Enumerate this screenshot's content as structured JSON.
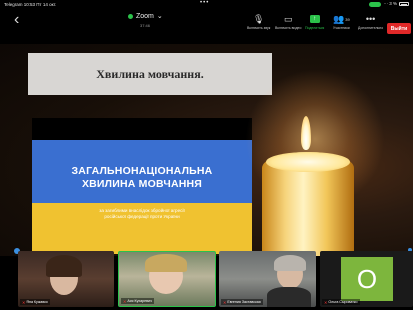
{
  "status_bar": {
    "left": "Telegram  10:53  Пт 14 окт.",
    "dots": "•••",
    "right": "⋯ 3 %"
  },
  "header": {
    "back_icon": "chevron-left-icon",
    "app_title": "Zoom",
    "title_chevron": "⌄",
    "subtitle": "37:46"
  },
  "toolbar": {
    "tools": [
      {
        "icon": "mic-muted-icon",
        "label": "Включить звук"
      },
      {
        "icon": "video-off-icon",
        "label": "Включить видео"
      },
      {
        "icon": "share-icon",
        "label": "Поделиться"
      },
      {
        "icon": "participants-icon",
        "label": "Участники",
        "count": "39"
      },
      {
        "icon": "more-icon",
        "label": "Дополнительно"
      }
    ],
    "leave_label": "Выйти"
  },
  "shared_slide": {
    "banner_text": "Хвилина мовчання.",
    "flag_title_line1": "ЗАГАЛЬНОНАЦІОНАЛЬНА",
    "flag_title_line2": "ХВИЛИНА МОВЧАННЯ",
    "flag_subtitle_line1": "за загиблими внаслідок збройної агресії",
    "flag_subtitle_line2": "російської федерації проти України"
  },
  "participants": [
    {
      "name": "Яна Кужавко",
      "muted": true
    },
    {
      "name": "Ася Кухаревич",
      "muted": true,
      "active_speaker": true
    },
    {
      "name": "Евгения Заставская",
      "muted": true
    },
    {
      "name": "Ольга Сыроватко",
      "muted": true,
      "avatar_letter": "О"
    }
  ],
  "colors": {
    "accent_green": "#2bc24a",
    "leave_red": "#e02828",
    "flag_blue": "#3a6fd0",
    "flag_yellow": "#f0c230",
    "avatar_green": "#7db63d"
  }
}
